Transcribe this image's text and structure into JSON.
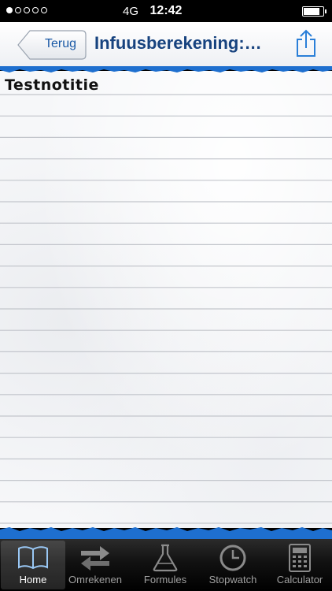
{
  "status_bar": {
    "network": "4G",
    "time": "12:42",
    "battery_level": 0.85
  },
  "nav": {
    "back_label": "Terug",
    "title": "Infuusberekening:…"
  },
  "note": {
    "text": "Testnotitie"
  },
  "tabs": [
    {
      "label": "Home",
      "icon": "book-icon",
      "selected": true
    },
    {
      "label": "Omrekenen",
      "icon": "swap-arrows-icon",
      "selected": false
    },
    {
      "label": "Formules",
      "icon": "flask-icon",
      "selected": false
    },
    {
      "label": "Stopwatch",
      "icon": "clock-icon",
      "selected": false
    },
    {
      "label": "Calculator",
      "icon": "calculator-icon",
      "selected": false
    }
  ],
  "colors": {
    "accent": "#1b5aa6",
    "title": "#17437f",
    "torn_edge": "#1e6fcf"
  }
}
